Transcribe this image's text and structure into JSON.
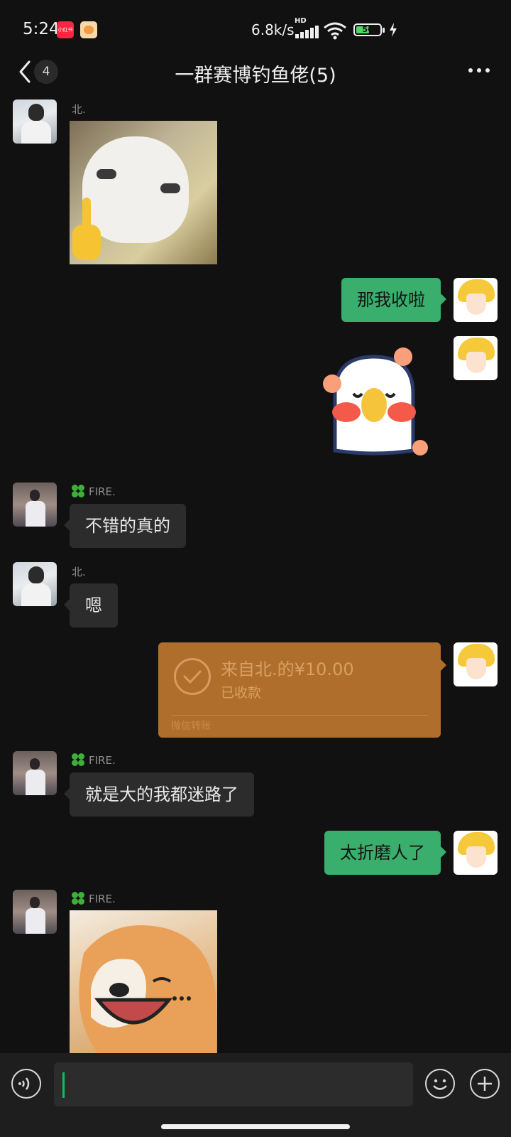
{
  "status_bar": {
    "time": "5:24",
    "app_badge_text": "小红书",
    "network_speed": "6.8k/s",
    "network_type": "HD",
    "battery": "56",
    "battery_level": 0.56,
    "icons": [
      "xiaohongshu-app-icon",
      "notification-app-icon",
      "signal-icon",
      "wifi-icon",
      "battery-icon",
      "charging-icon"
    ]
  },
  "header": {
    "unread_count": "4",
    "title": "一群赛博钓鱼佬(5)",
    "icons": [
      "back-icon",
      "more-icon"
    ]
  },
  "messages": [
    {
      "type": "sticker",
      "side": "left",
      "sender": "北.",
      "sticker": "cat-pointing-sticker"
    },
    {
      "type": "text",
      "side": "right",
      "text": "那我收啦"
    },
    {
      "type": "sticker",
      "side": "right",
      "sticker": "duck-blushing-sticker"
    },
    {
      "type": "text",
      "side": "left",
      "sender": "FIRE.",
      "text": "不错的真的"
    },
    {
      "type": "text",
      "side": "left",
      "sender": "北.",
      "text": "嗯"
    },
    {
      "type": "transfer",
      "side": "right",
      "title": "来自北.的¥10.00",
      "status": "已收款",
      "source": "微信转账"
    },
    {
      "type": "text",
      "side": "left",
      "sender": "FIRE.",
      "text": "就是大的我都迷路了"
    },
    {
      "type": "text",
      "side": "right",
      "text": "太折磨人了"
    },
    {
      "type": "sticker",
      "side": "left",
      "sender": "FIRE.",
      "sticker": "shiba-laughing-sticker"
    }
  ],
  "input_bar": {
    "text": "",
    "icons": [
      "voice-icon",
      "emoji-icon",
      "plus-icon"
    ]
  },
  "colors": {
    "background": "#111111",
    "bubble_self": "#3aae6c",
    "bubble_other": "#2c2c2c",
    "transfer_card": "#b06e2c",
    "caret": "#07c160"
  }
}
